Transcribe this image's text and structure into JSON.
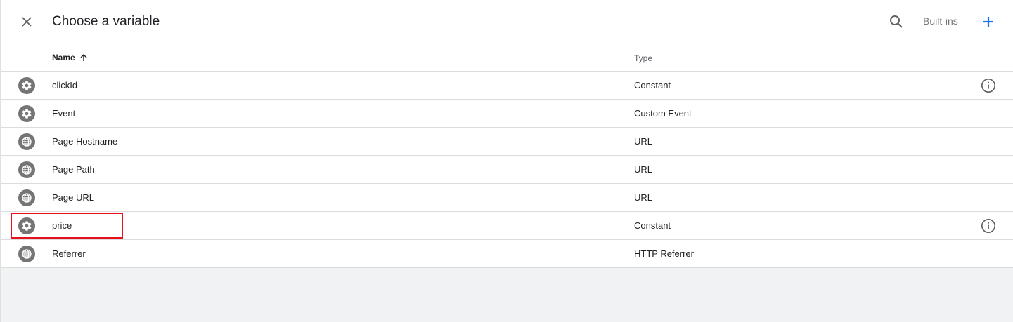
{
  "header": {
    "title": "Choose a variable",
    "builtins_label": "Built-ins"
  },
  "columns": {
    "name": "Name",
    "type": "Type"
  },
  "rows": [
    {
      "name": "clickId",
      "type": "Constant",
      "icon": "gear-icon",
      "info": true
    },
    {
      "name": "Event",
      "type": "Custom Event",
      "icon": "gear-icon",
      "info": false
    },
    {
      "name": "Page Hostname",
      "type": "URL",
      "icon": "globe-icon",
      "info": false
    },
    {
      "name": "Page Path",
      "type": "URL",
      "icon": "globe-icon",
      "info": false
    },
    {
      "name": "Page URL",
      "type": "URL",
      "icon": "globe-icon",
      "info": false
    },
    {
      "name": "price",
      "type": "Constant",
      "icon": "gear-icon",
      "info": true
    },
    {
      "name": "Referrer",
      "type": "HTTP Referrer",
      "icon": "globe-icon",
      "info": false
    }
  ],
  "colors": {
    "accent": "#1a73e8",
    "icon_grey": "#757575",
    "highlight": "#e8111b"
  }
}
